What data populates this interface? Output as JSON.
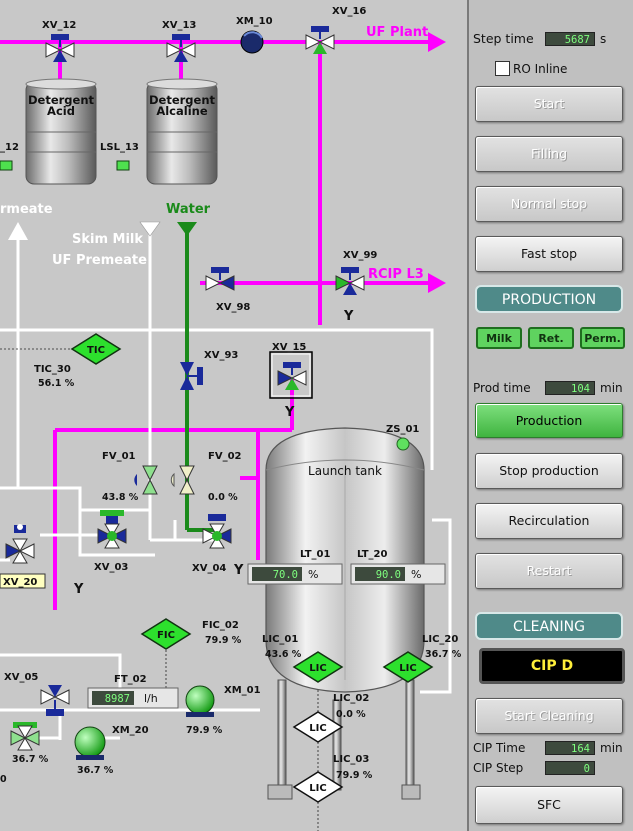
{
  "process": {
    "valves": {
      "xv12": "XV_12",
      "xv13": "XV_13",
      "xv16": "XV_16",
      "xv98": "XV_98",
      "xv99": "XV_99",
      "xv93": "XV_93",
      "xv15": "XV_15",
      "fv01": "FV_01",
      "fv02": "FV_02",
      "xv03": "XV_03",
      "xv04": "XV_04",
      "xv20": "XV_20",
      "xv05": "XV_05"
    },
    "motors": {
      "xm10": "XM_10",
      "xm01": "XM_01",
      "xm20": "XM_20"
    },
    "tanks": {
      "acid": "Detergent\nAcid",
      "acid_l1": "Detergent",
      "acid_l2": "Acid",
      "alk_l1": "Detergent",
      "alk_l2": "Alcaline"
    },
    "switches": {
      "lsl12": "_12",
      "lsl13": "LSL_13",
      "zs01": "ZS_01"
    },
    "lines": {
      "uf_plant": "UF Plant",
      "rcip_l3": "RCIP L3",
      "water": "Water",
      "permeate": "rmeate",
      "skim_milk": "Skim Milk",
      "uf_premeate": "UF Premeate"
    },
    "y_marks": {
      "y": "Y"
    },
    "controllers": {
      "tic": "TIC",
      "tic30": "TIC_30",
      "tic30_val": "56.1 %",
      "fic": "FIC",
      "fic02": "FIC_02",
      "fic02_val": "79.9 %",
      "lic": "LIC",
      "lic01": "LIC_01",
      "lic01_val": "43.6 %",
      "lic20": "LIC_20",
      "lic20_val": "36.7 %",
      "lic02": "LIC_02",
      "lic02_val": "0.0 %",
      "lic03": "LIC_03",
      "lic03_val": "79.9 %"
    },
    "values": {
      "fv01_val": "43.8 %",
      "fv02_val": "0.0 %",
      "xm01_val": "79.9 %",
      "xm20_val": "36.7 %",
      "left_val": "36.7 %",
      "left_zero": "0"
    },
    "level": {
      "lt01": "LT_01",
      "lt01_val": "70.0",
      "lt20": "LT_20",
      "lt20_val": "90.0",
      "unit": "%"
    },
    "flow": {
      "ft02": "FT_02",
      "ft02_val": "8987",
      "unit": "l/h"
    },
    "launch_tank": "Launch tank"
  },
  "panel": {
    "step_time_label": "Step time",
    "step_time_value": "5687",
    "step_time_unit": "s",
    "ro_inline": "RO Inline",
    "buttons": {
      "start": "Start",
      "filling": "Filling",
      "normal_stop": "Normal stop",
      "fast_stop": "Fast stop",
      "production": "Production",
      "stop_production": "Stop production",
      "recirculation": "Recirculation",
      "restart": "Restart",
      "start_cleaning": "Start Cleaning",
      "sfc": "SFC"
    },
    "production_header": "PRODUCTION",
    "chips": {
      "milk": "Milk",
      "ret": "Ret.",
      "perm": "Perm."
    },
    "prod_time_label": "Prod time",
    "prod_time_value": "104",
    "prod_time_unit": "min",
    "cleaning_header": "CLEANING",
    "cip_program": "CIP D",
    "cip_time_label": "CIP Time",
    "cip_time_value": "164",
    "cip_time_unit": "min",
    "cip_step_label": "CIP Step",
    "cip_step_value": "0"
  }
}
